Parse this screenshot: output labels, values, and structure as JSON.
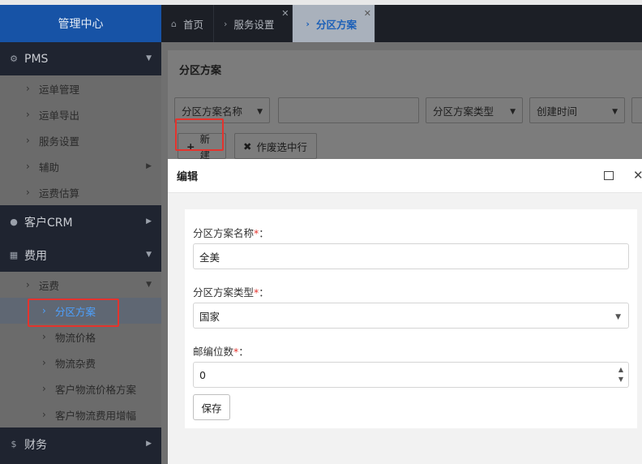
{
  "sidebar": {
    "brand": "管理中心",
    "pms": {
      "label": "PMS",
      "items": [
        "运单管理",
        "运单导出",
        "服务设置",
        "辅助",
        "运费估算"
      ]
    },
    "crm": {
      "label": "客户CRM"
    },
    "fees": {
      "label": "费用",
      "sub_group": "运费",
      "sub_items": [
        "分区方案",
        "物流价格",
        "物流杂费",
        "客户物流价格方案",
        "客户物流费用增幅"
      ]
    },
    "finance": {
      "label": "财务"
    }
  },
  "tabs": [
    {
      "label": "首页"
    },
    {
      "label": "服务设置"
    },
    {
      "label": "分区方案"
    }
  ],
  "page": {
    "title": "分区方案",
    "filters": {
      "name_select": "分区方案名称",
      "name_input": "",
      "type_select": "分区方案类型",
      "created_select": "创建时间"
    },
    "buttons": {
      "new": "新建",
      "void_selected": "作废选中行"
    }
  },
  "dialog": {
    "title": "编辑",
    "fields": {
      "name_label": "分区方案名称",
      "name_value": "全美",
      "type_label": "分区方案类型",
      "type_value": "国家",
      "postcode_label": "邮编位数",
      "postcode_value": "0"
    },
    "required_mark": "*",
    "colon": "：",
    "save": "保存"
  }
}
